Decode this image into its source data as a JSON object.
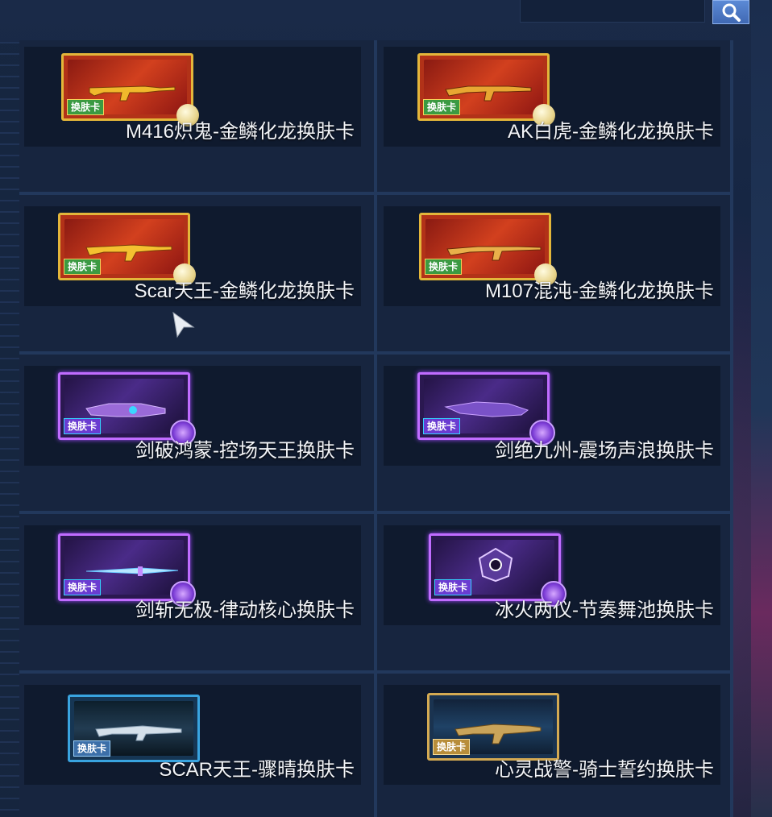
{
  "search": {
    "placeholder": "",
    "button_icon": "search-icon"
  },
  "items": [
    {
      "label": "M416炽鬼-金鳞化龙换肤卡",
      "tag": "换肤卡",
      "style": "red",
      "icon": "rifle-icon"
    },
    {
      "label": "AK白虎-金鳞化龙换肤卡",
      "tag": "换肤卡",
      "style": "red",
      "icon": "rifle-icon"
    },
    {
      "label": "Scar天王-金鳞化龙换肤卡",
      "tag": "换肤卡",
      "style": "red",
      "icon": "rifle-icon"
    },
    {
      "label": "M107混沌-金鳞化龙换肤卡",
      "tag": "换肤卡",
      "style": "red",
      "icon": "sniper-icon"
    },
    {
      "label": "剑破鸿蒙-控场天王换肤卡",
      "tag": "换肤卡",
      "style": "purple",
      "icon": "blaster-icon"
    },
    {
      "label": "剑绝九州-震场声浪换肤卡",
      "tag": "换肤卡",
      "style": "purple",
      "icon": "blaster-icon"
    },
    {
      "label": "剑斩无极-律动核心换肤卡",
      "tag": "换肤卡",
      "style": "purple",
      "icon": "blade-icon"
    },
    {
      "label": "冰火两仪-节奏舞池换肤卡",
      "tag": "换肤卡",
      "style": "purple",
      "icon": "orb-icon"
    },
    {
      "label": "SCAR天王-骤晴换肤卡",
      "tag": "换肤卡",
      "style": "blue",
      "icon": "rifle-icon"
    },
    {
      "label": "心灵战警-骑士誓约换肤卡",
      "tag": "换肤卡",
      "style": "gold",
      "icon": "rifle-icon"
    }
  ],
  "colors": {
    "background": "#0f1b30",
    "card": "#0f1a2e",
    "grid_line": "#22385c",
    "label_text": "#f2f4f8",
    "search_button": "#4a78c6"
  }
}
